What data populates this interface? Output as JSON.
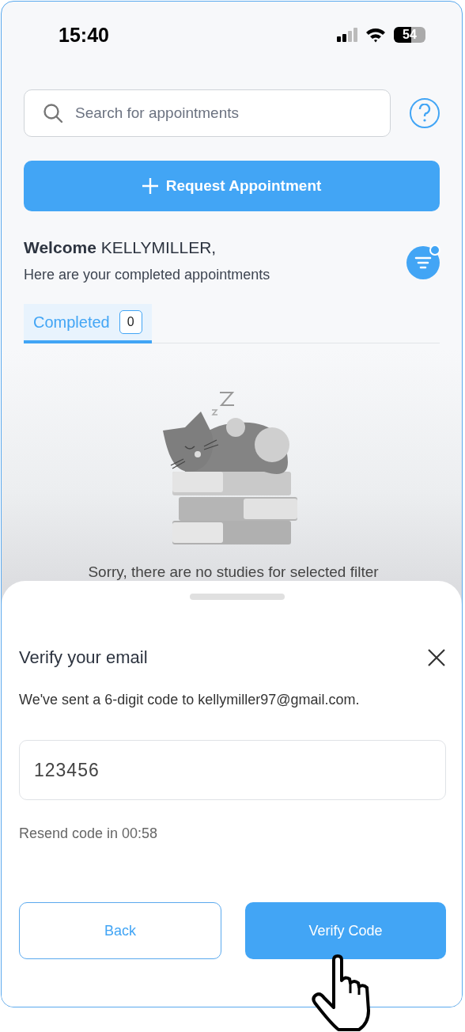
{
  "status_bar": {
    "time": "15:40",
    "battery": "54"
  },
  "search": {
    "placeholder": "Search for appointments"
  },
  "request_button": {
    "label": "Request Appointment"
  },
  "welcome": {
    "title": "**Welcome** KELLYMILLER,",
    "subtitle": "Here are your completed appointments"
  },
  "tabs": [
    {
      "label": "Completed",
      "count": "0",
      "selected": true
    }
  ],
  "empty_state": {
    "message": "Sorry, there are no studies for selected filter"
  },
  "dialog": {
    "title": "Verify your email",
    "message": "We've sent a 6-digit code to kellymiller97@gmail.com.",
    "code": {
      "value": "123456"
    },
    "resend": "Resend code in 00:58",
    "buttons": [
      {
        "label": "Back",
        "kind": "secondary"
      },
      {
        "label": "Verify Code",
        "kind": "primary"
      }
    ]
  }
}
